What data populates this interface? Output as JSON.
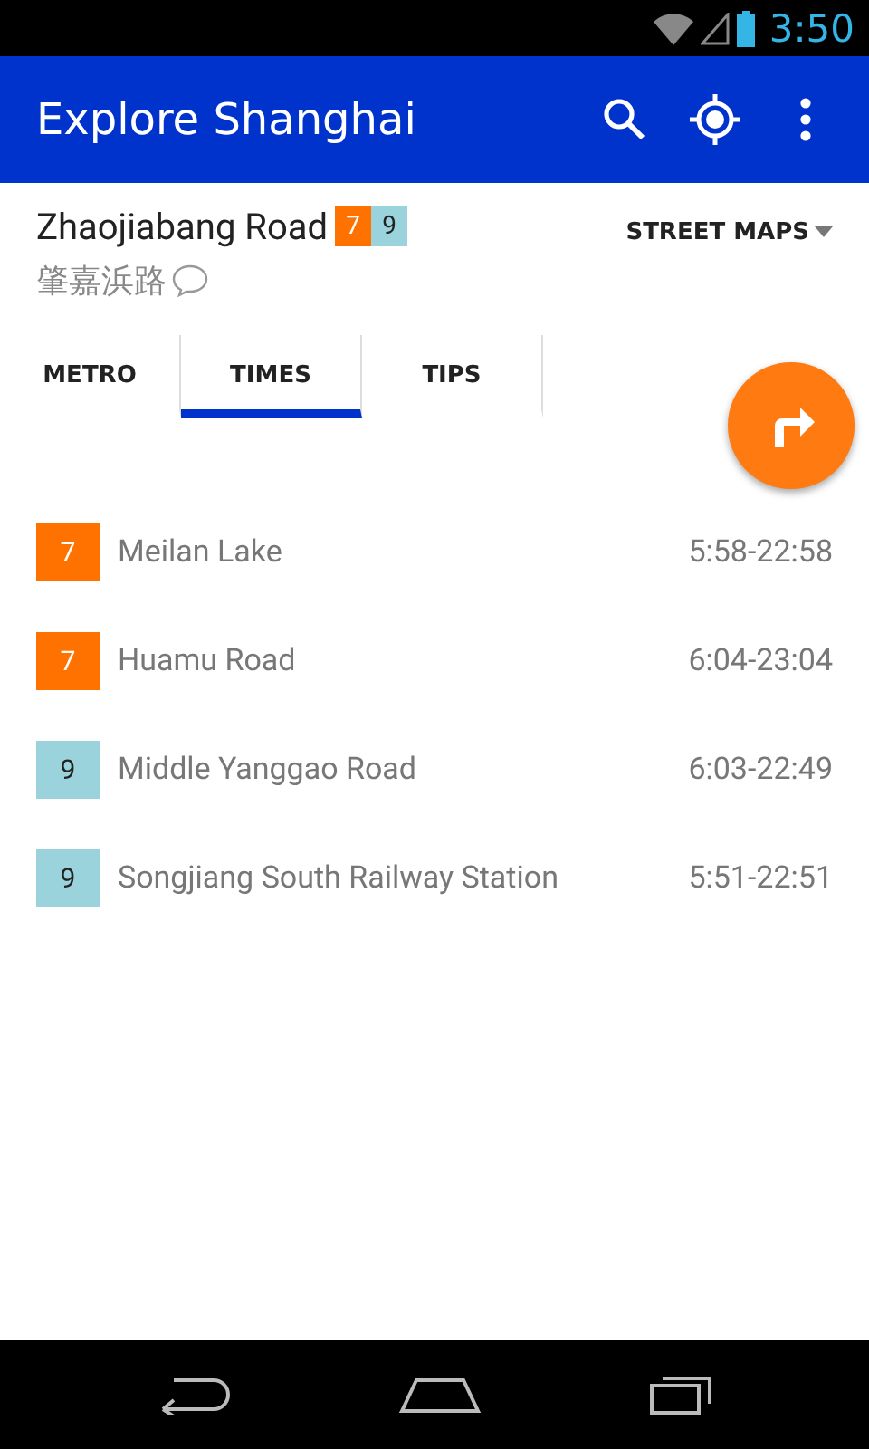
{
  "status_bar": {
    "time": "3:50"
  },
  "app_bar": {
    "title": "Explore Shanghai"
  },
  "station": {
    "name": "Zhaojiabang Road",
    "name_local": "肇嘉浜路",
    "lines": [
      {
        "label": "7",
        "color": "#ff7200"
      },
      {
        "label": "9",
        "color": "#9bd3dc"
      }
    ],
    "maps_menu": "STREET MAPS"
  },
  "tabs": [
    {
      "label": "METRO",
      "selected": false
    },
    {
      "label": "TIMES",
      "selected": true
    },
    {
      "label": "TIPS",
      "selected": false
    }
  ],
  "timetable": [
    {
      "line": "7",
      "color": "#ff7200",
      "destination": "Meilan Lake",
      "hours": "5:58-22:58"
    },
    {
      "line": "7",
      "color": "#ff7200",
      "destination": "Huamu Road",
      "hours": "6:04-23:04"
    },
    {
      "line": "9",
      "color": "#9bd3dc",
      "destination": "Middle Yanggao Road",
      "hours": "6:03-22:49"
    },
    {
      "line": "9",
      "color": "#9bd3dc",
      "destination": "Songjiang South Railway Station",
      "hours": "5:51-22:51"
    }
  ]
}
